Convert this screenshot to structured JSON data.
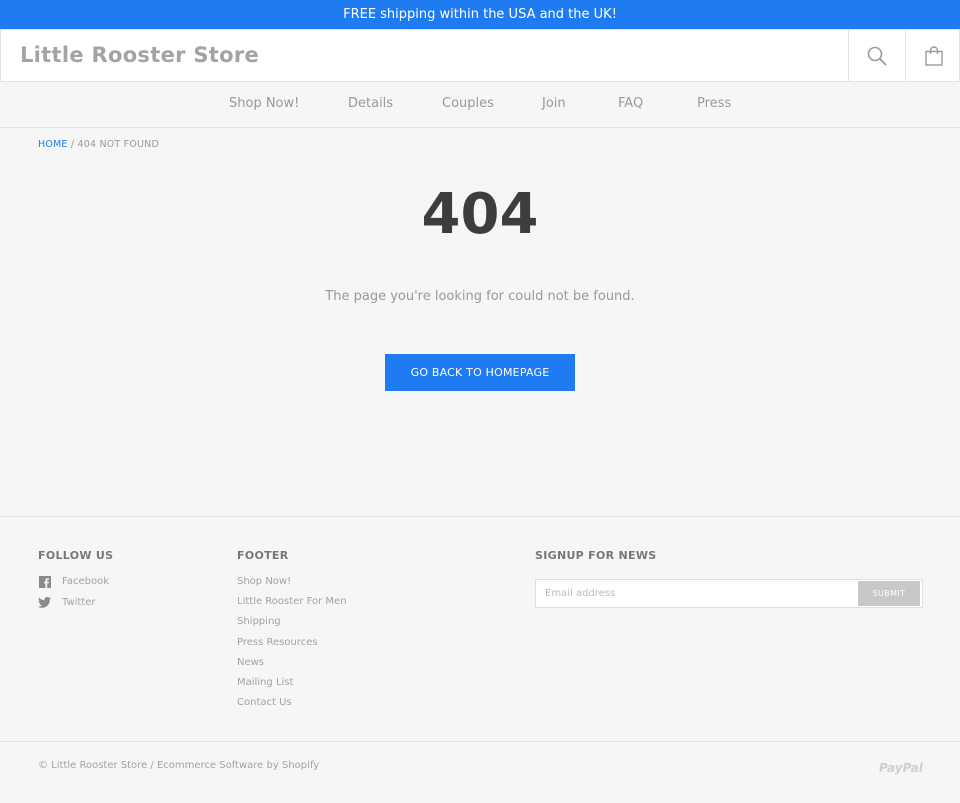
{
  "announcement": "FREE shipping within the USA and the UK!",
  "header": {
    "store_name": "Little Rooster Store",
    "search_icon": "search-icon",
    "cart_icon": "shopping-bag-icon"
  },
  "nav": {
    "items": [
      {
        "label": "Shop Now!"
      },
      {
        "label": "Details"
      },
      {
        "label": "Couples"
      },
      {
        "label": "Join"
      },
      {
        "label": "FAQ"
      },
      {
        "label": "Press"
      }
    ]
  },
  "breadcrumb": {
    "home": "HOME",
    "separator": "/",
    "current": "404 NOT FOUND"
  },
  "error": {
    "code": "404",
    "message": "The page you're looking for could not be found.",
    "button_label": "GO BACK TO HOMEPAGE"
  },
  "footer": {
    "follow": {
      "heading": "FOLLOW US",
      "links": [
        {
          "label": "Facebook",
          "icon": "facebook-icon"
        },
        {
          "label": "Twitter",
          "icon": "twitter-icon"
        }
      ]
    },
    "links": {
      "heading": "FOOTER",
      "items": [
        {
          "label": "Shop Now!"
        },
        {
          "label": "Little Rooster For Men"
        },
        {
          "label": "Shipping"
        },
        {
          "label": "Press Resources"
        },
        {
          "label": "News"
        },
        {
          "label": "Mailing List"
        },
        {
          "label": "Contact Us"
        }
      ]
    },
    "signup": {
      "heading": "SIGNUP FOR NEWS",
      "placeholder": "Email address",
      "submit_label": "SUBMIT"
    }
  },
  "bottom": {
    "copyright": "© Little Rooster Store / Ecommerce Software by Shopify",
    "payment": "PayPal"
  },
  "colors": {
    "accent": "#1f7bf2",
    "background": "#f6f6f6",
    "heading_dark": "#3d3d3d"
  }
}
